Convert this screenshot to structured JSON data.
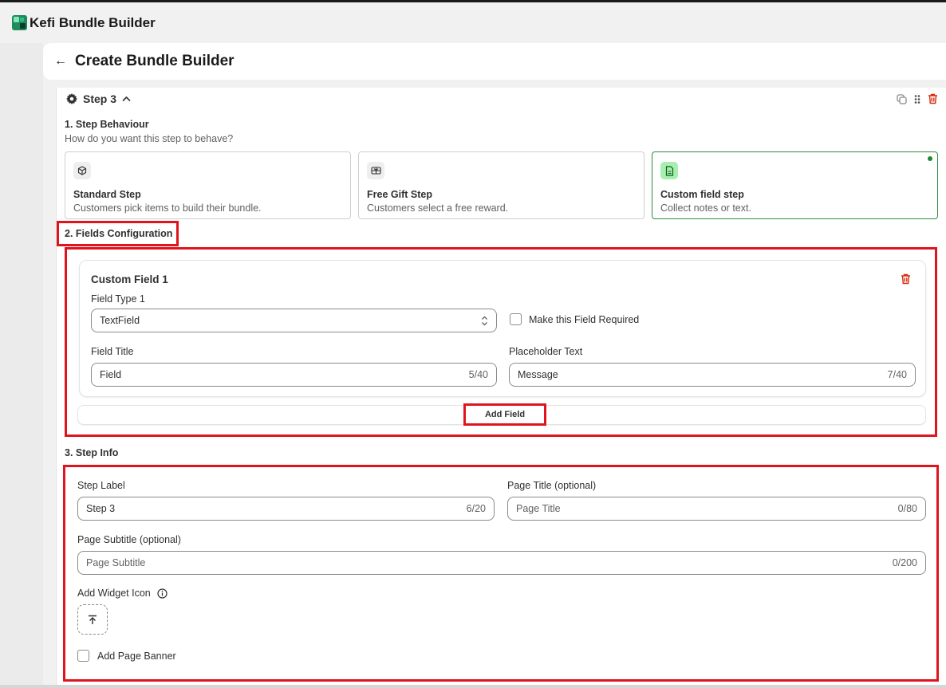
{
  "app": {
    "title": "Kefi Bundle Builder"
  },
  "header": {
    "back_icon": "arrow-left-icon",
    "title": "Create Bundle Builder"
  },
  "step": {
    "label": "Step 3",
    "actions": [
      "duplicate-icon",
      "drag-handle-icon",
      "delete-icon"
    ]
  },
  "behaviour": {
    "title": "1. Step Behaviour",
    "subtitle": "How do you want this step to behave?",
    "options": [
      {
        "title": "Standard Step",
        "desc": "Customers pick items to build their bundle.",
        "icon": "cube-icon",
        "selected": false
      },
      {
        "title": "Free Gift Step",
        "desc": "Customers select a free reward.",
        "icon": "gift-icon",
        "selected": false
      },
      {
        "title": "Custom field step",
        "desc": "Collect notes or text.",
        "icon": "document-icon",
        "selected": true
      }
    ]
  },
  "fields_config": {
    "title": "2. Fields Configuration",
    "field": {
      "title": "Custom Field 1",
      "type_label": "Field Type 1",
      "type_value": "TextField",
      "required_label": "Make this Field Required",
      "field_title_label": "Field Title",
      "field_title_value": "Field",
      "field_title_count": "5/40",
      "placeholder_label": "Placeholder Text",
      "placeholder_value": "Message",
      "placeholder_count": "7/40"
    },
    "add_field_label": "Add Field"
  },
  "step_info": {
    "title": "3. Step Info",
    "step_label_label": "Step Label",
    "step_label_value": "Step 3",
    "step_label_count": "6/20",
    "page_title_label": "Page Title (optional)",
    "page_title_placeholder": "Page Title",
    "page_title_count": "0/80",
    "page_subtitle_label": "Page Subtitle (optional)",
    "page_subtitle_placeholder": "Page Subtitle",
    "page_subtitle_count": "0/200",
    "widget_icon_label": "Add Widget Icon",
    "page_banner_label": "Add Page Banner"
  },
  "colors": {
    "highlight": "#e0141c",
    "selected": "#2e8b3e",
    "danger": "#d72c0d"
  }
}
